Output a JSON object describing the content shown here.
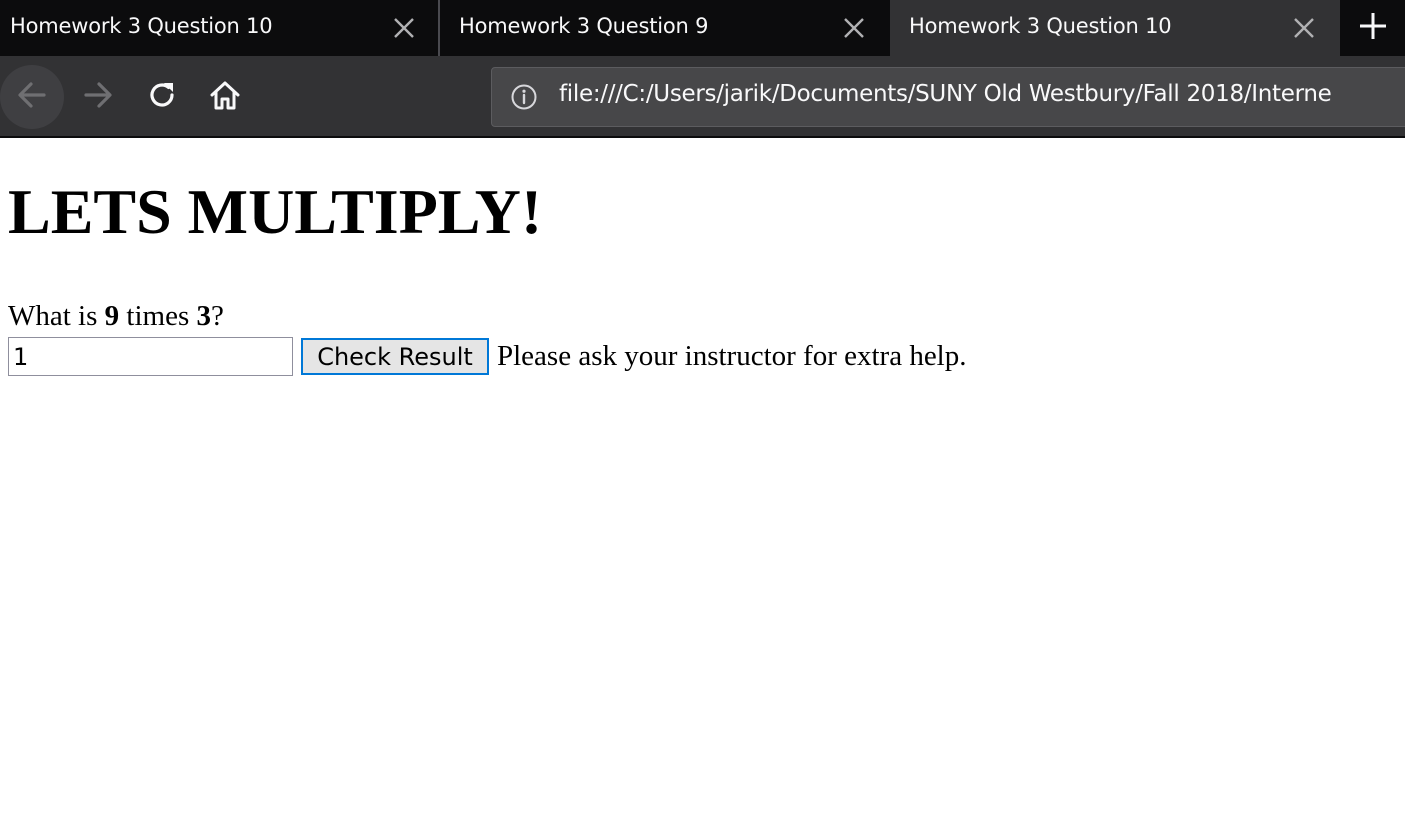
{
  "browser": {
    "tabs": [
      {
        "title": "Homework 3 Question 10",
        "active": false
      },
      {
        "title": "Homework 3 Question 9",
        "active": false
      },
      {
        "title": "Homework 3 Question 10",
        "active": true
      }
    ],
    "url": "file:///C:/Users/jarik/Documents/SUNY Old Westbury/Fall 2018/Interne",
    "icons": {
      "tab_close": "close-icon",
      "new_tab": "plus-icon",
      "back": "arrow-left-icon",
      "forward": "arrow-right-icon",
      "reload": "reload-icon",
      "home": "home-icon",
      "site_info": "info-icon"
    },
    "colors": {
      "tabstrip_bg": "#0c0c0d",
      "active_tab_bg": "#323234",
      "toolbar_bg": "#323234",
      "urlbar_bg": "#474749",
      "button_focus": "#0078d7"
    }
  },
  "page": {
    "heading": "LETS MULTIPLY!",
    "question": {
      "prefix": "What is ",
      "first_number": "9",
      "middle": " times ",
      "second_number": "3",
      "suffix": "?"
    },
    "answer_value": "1",
    "check_button_label": "Check Result",
    "feedback": "Please ask your instructor for extra help."
  }
}
